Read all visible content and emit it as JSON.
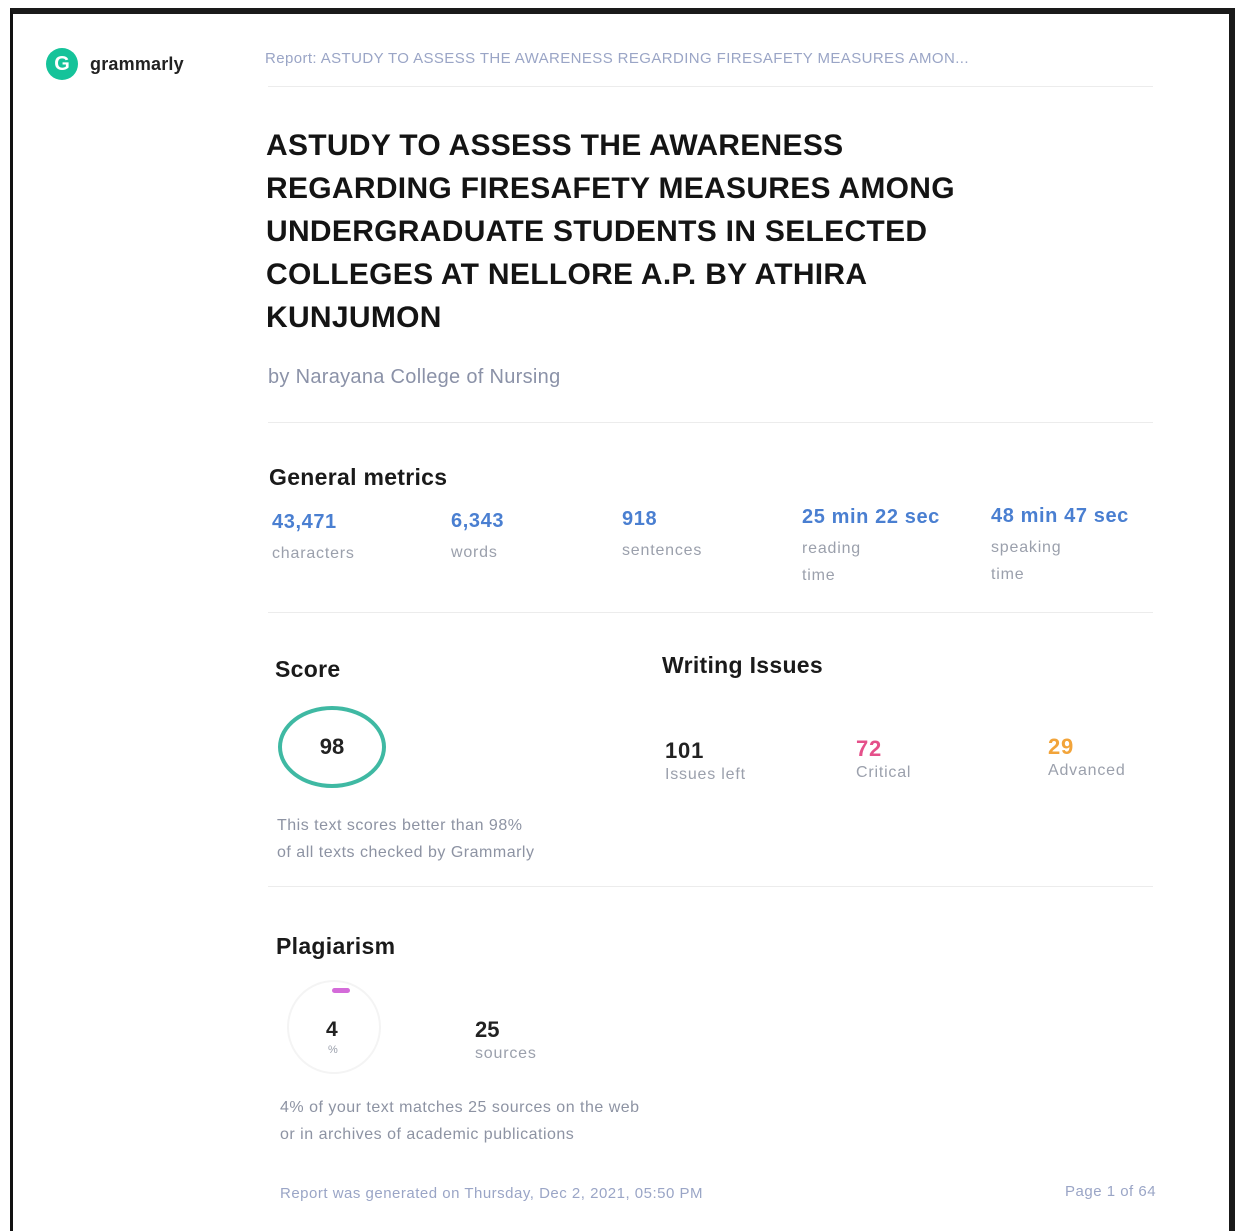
{
  "header": {
    "logo_glyph": "G",
    "logo_text": "grammarly",
    "report_title": "Report: ASTUDY TO ASSESS THE AWARENESS REGARDING FIRESAFETY MEASURES AMON..."
  },
  "document": {
    "title_lines": [
      "ASTUDY TO ASSESS THE AWARENESS",
      "REGARDING FIRESAFETY MEASURES AMONG",
      "UNDERGRADUATE STUDENTS IN SELECTED",
      "COLLEGES AT NELLORE A.P. BY ATHIRA",
      "KUNJUMON"
    ],
    "author": "by Narayana College of Nursing"
  },
  "general_metrics": {
    "heading": "General metrics",
    "items": [
      {
        "value": "43,471",
        "label": "characters"
      },
      {
        "value": "6,343",
        "label": "words"
      },
      {
        "value": "918",
        "label": "sentences"
      },
      {
        "value": "25 min 22 sec",
        "label_lines": [
          "reading",
          "time"
        ]
      },
      {
        "value": "48 min 47 sec",
        "label_lines": [
          "speaking",
          "time"
        ]
      }
    ]
  },
  "score": {
    "heading": "Score",
    "value": "98",
    "note_lines": [
      "This text scores better than 98%",
      "of all texts checked by Grammarly"
    ]
  },
  "writing_issues": {
    "heading": "Writing Issues",
    "items": [
      {
        "value": "101",
        "label": "Issues left",
        "color": "#222222"
      },
      {
        "value": "72",
        "label": "Critical",
        "color": "#e5508a"
      },
      {
        "value": "29",
        "label": "Advanced",
        "color": "#f2a43a"
      }
    ]
  },
  "plagiarism": {
    "heading": "Plagiarism",
    "percent": "4",
    "percent_unit": "%",
    "sources_value": "25",
    "sources_label": "sources",
    "note_lines": [
      "4% of your text matches 25 sources on the web",
      "or in archives of academic publications"
    ]
  },
  "footer": {
    "generated": "Report was generated on Thursday, Dec 2, 2021, 05:50 PM",
    "page": "Page 1 of 64"
  },
  "colors": {
    "brand": "#15c39a",
    "metric_blue": "#4a7fd1",
    "score_ring": "#3fb9a3",
    "plagiarism_arc": "#d46bd9"
  }
}
